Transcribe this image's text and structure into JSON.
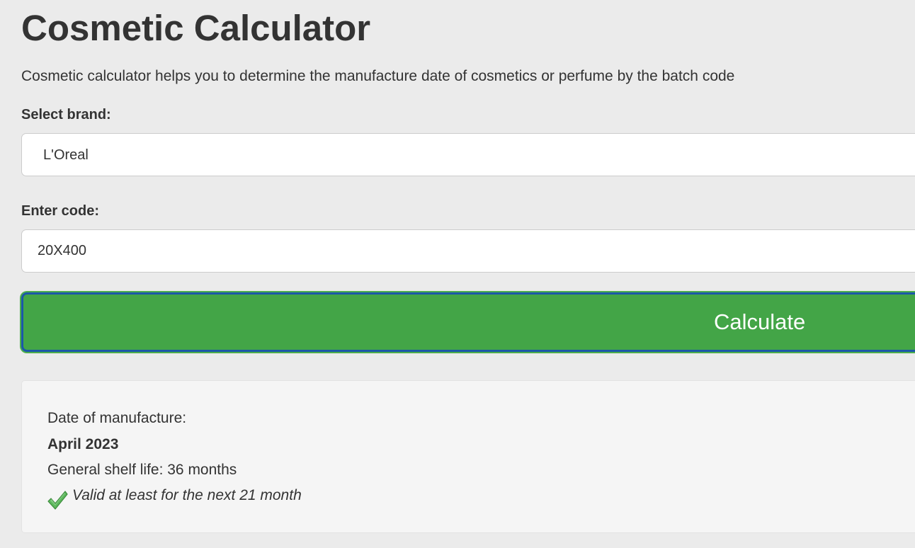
{
  "page": {
    "title": "Cosmetic Calculator",
    "description": "Cosmetic calculator helps you to determine the manufacture date of cosmetics or perfume by the batch code"
  },
  "form": {
    "brand_label": "Select brand:",
    "brand_selected": "L'Oreal",
    "code_label": "Enter code:",
    "code_value": "20X400",
    "calculate_label": "Calculate"
  },
  "result": {
    "date_label": "Date of manufacture:",
    "date_value": "April 2023",
    "shelf_life": "General shelf life: 36 months",
    "validity": "Valid at least for the next 21 month",
    "validity_icon": "check-icon"
  },
  "colors": {
    "button_green": "#43a547",
    "button_focus_border": "#1b58a8",
    "check_green": "#5cb85c"
  }
}
